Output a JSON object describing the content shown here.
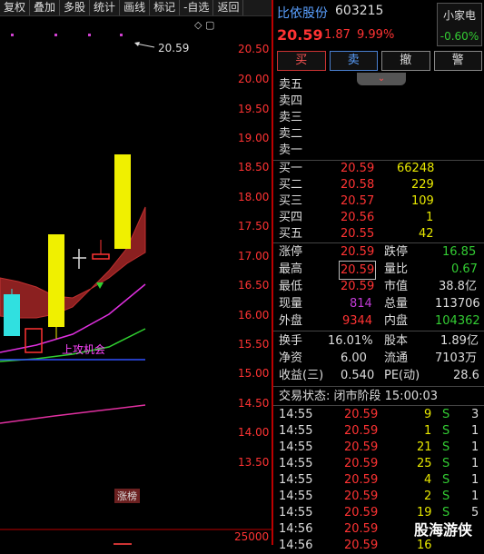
{
  "toolbar": [
    "复权",
    "叠加",
    "多股",
    "统计",
    "画线",
    "标记",
    "-自选",
    "返回"
  ],
  "chart": {
    "price_labels": [
      "20.50",
      "20.00",
      "19.50",
      "19.00",
      "18.50",
      "18.00",
      "17.50",
      "17.00",
      "16.50",
      "16.00",
      "15.50",
      "15.00",
      "14.50",
      "14.00",
      "13.50"
    ],
    "bottom_label": "25000",
    "high_annotation": "20.59",
    "signal_text": "上攻机会",
    "tag_button": "涨榜",
    "icon_names": [
      "diamond-icon",
      "window-icon"
    ]
  },
  "quote": {
    "name": "比依股份",
    "code": "603215",
    "price": "20.59",
    "change": "1.87",
    "pct": "9.99%",
    "side_btn_top": "小家电",
    "side_btn_bottom": "-0.60%",
    "actions": [
      "买",
      "卖",
      "撤",
      "警"
    ]
  },
  "asks": [
    {
      "label": "卖五",
      "price": "",
      "vol": ""
    },
    {
      "label": "卖四",
      "price": "",
      "vol": ""
    },
    {
      "label": "卖三",
      "price": "",
      "vol": ""
    },
    {
      "label": "卖二",
      "price": "",
      "vol": ""
    },
    {
      "label": "卖一",
      "price": "",
      "vol": ""
    }
  ],
  "bids": [
    {
      "label": "买一",
      "price": "20.59",
      "vol": "66248"
    },
    {
      "label": "买二",
      "price": "20.58",
      "vol": "229"
    },
    {
      "label": "买三",
      "price": "20.57",
      "vol": "109"
    },
    {
      "label": "买四",
      "price": "20.56",
      "vol": "1"
    },
    {
      "label": "买五",
      "price": "20.55",
      "vol": "42"
    }
  ],
  "stats": {
    "zt_label": "涨停",
    "zt": "20.59",
    "dt_label": "跌停",
    "dt": "16.85",
    "hi_label": "最高",
    "hi": "20.59",
    "lb_label": "量比",
    "lb": "0.67",
    "lo_label": "最低",
    "lo": "20.59",
    "sz_label": "市值",
    "sz": "38.8亿",
    "xl_label": "现量",
    "xl": "814",
    "zl_label": "总量",
    "zl": "113706",
    "wp_label": "外盘",
    "wp": "9344",
    "np_label": "内盘",
    "np": "104362",
    "hs_label": "换手",
    "hs": "16.01%",
    "gb_label": "股本",
    "gb": "1.89亿",
    "jz_label": "净资",
    "jz": "6.00",
    "lt_label": "流通",
    "lt": "7103万",
    "sy_label": "收益(三)",
    "sy": "0.540",
    "pe_label": "PE(动)",
    "pe": "28.6"
  },
  "status": "交易状态: 闭市阶段 15:00:03",
  "ticks": [
    {
      "time": "14:55",
      "price": "20.59",
      "vol": "9",
      "bs": "S",
      "n": "3"
    },
    {
      "time": "14:55",
      "price": "20.59",
      "vol": "1",
      "bs": "S",
      "n": "1"
    },
    {
      "time": "14:55",
      "price": "20.59",
      "vol": "21",
      "bs": "S",
      "n": "1"
    },
    {
      "time": "14:55",
      "price": "20.59",
      "vol": "25",
      "bs": "S",
      "n": "1"
    },
    {
      "time": "14:55",
      "price": "20.59",
      "vol": "4",
      "bs": "S",
      "n": "1"
    },
    {
      "time": "14:55",
      "price": "20.59",
      "vol": "2",
      "bs": "S",
      "n": "1"
    },
    {
      "time": "14:55",
      "price": "20.59",
      "vol": "19",
      "bs": "S",
      "n": "5"
    },
    {
      "time": "14:56",
      "price": "20.59",
      "vol": "",
      "bs": "",
      "n": ""
    },
    {
      "time": "14:56",
      "price": "20.59",
      "vol": "16",
      "bs": "",
      "n": ""
    }
  ],
  "watermark": "股海游侠"
}
